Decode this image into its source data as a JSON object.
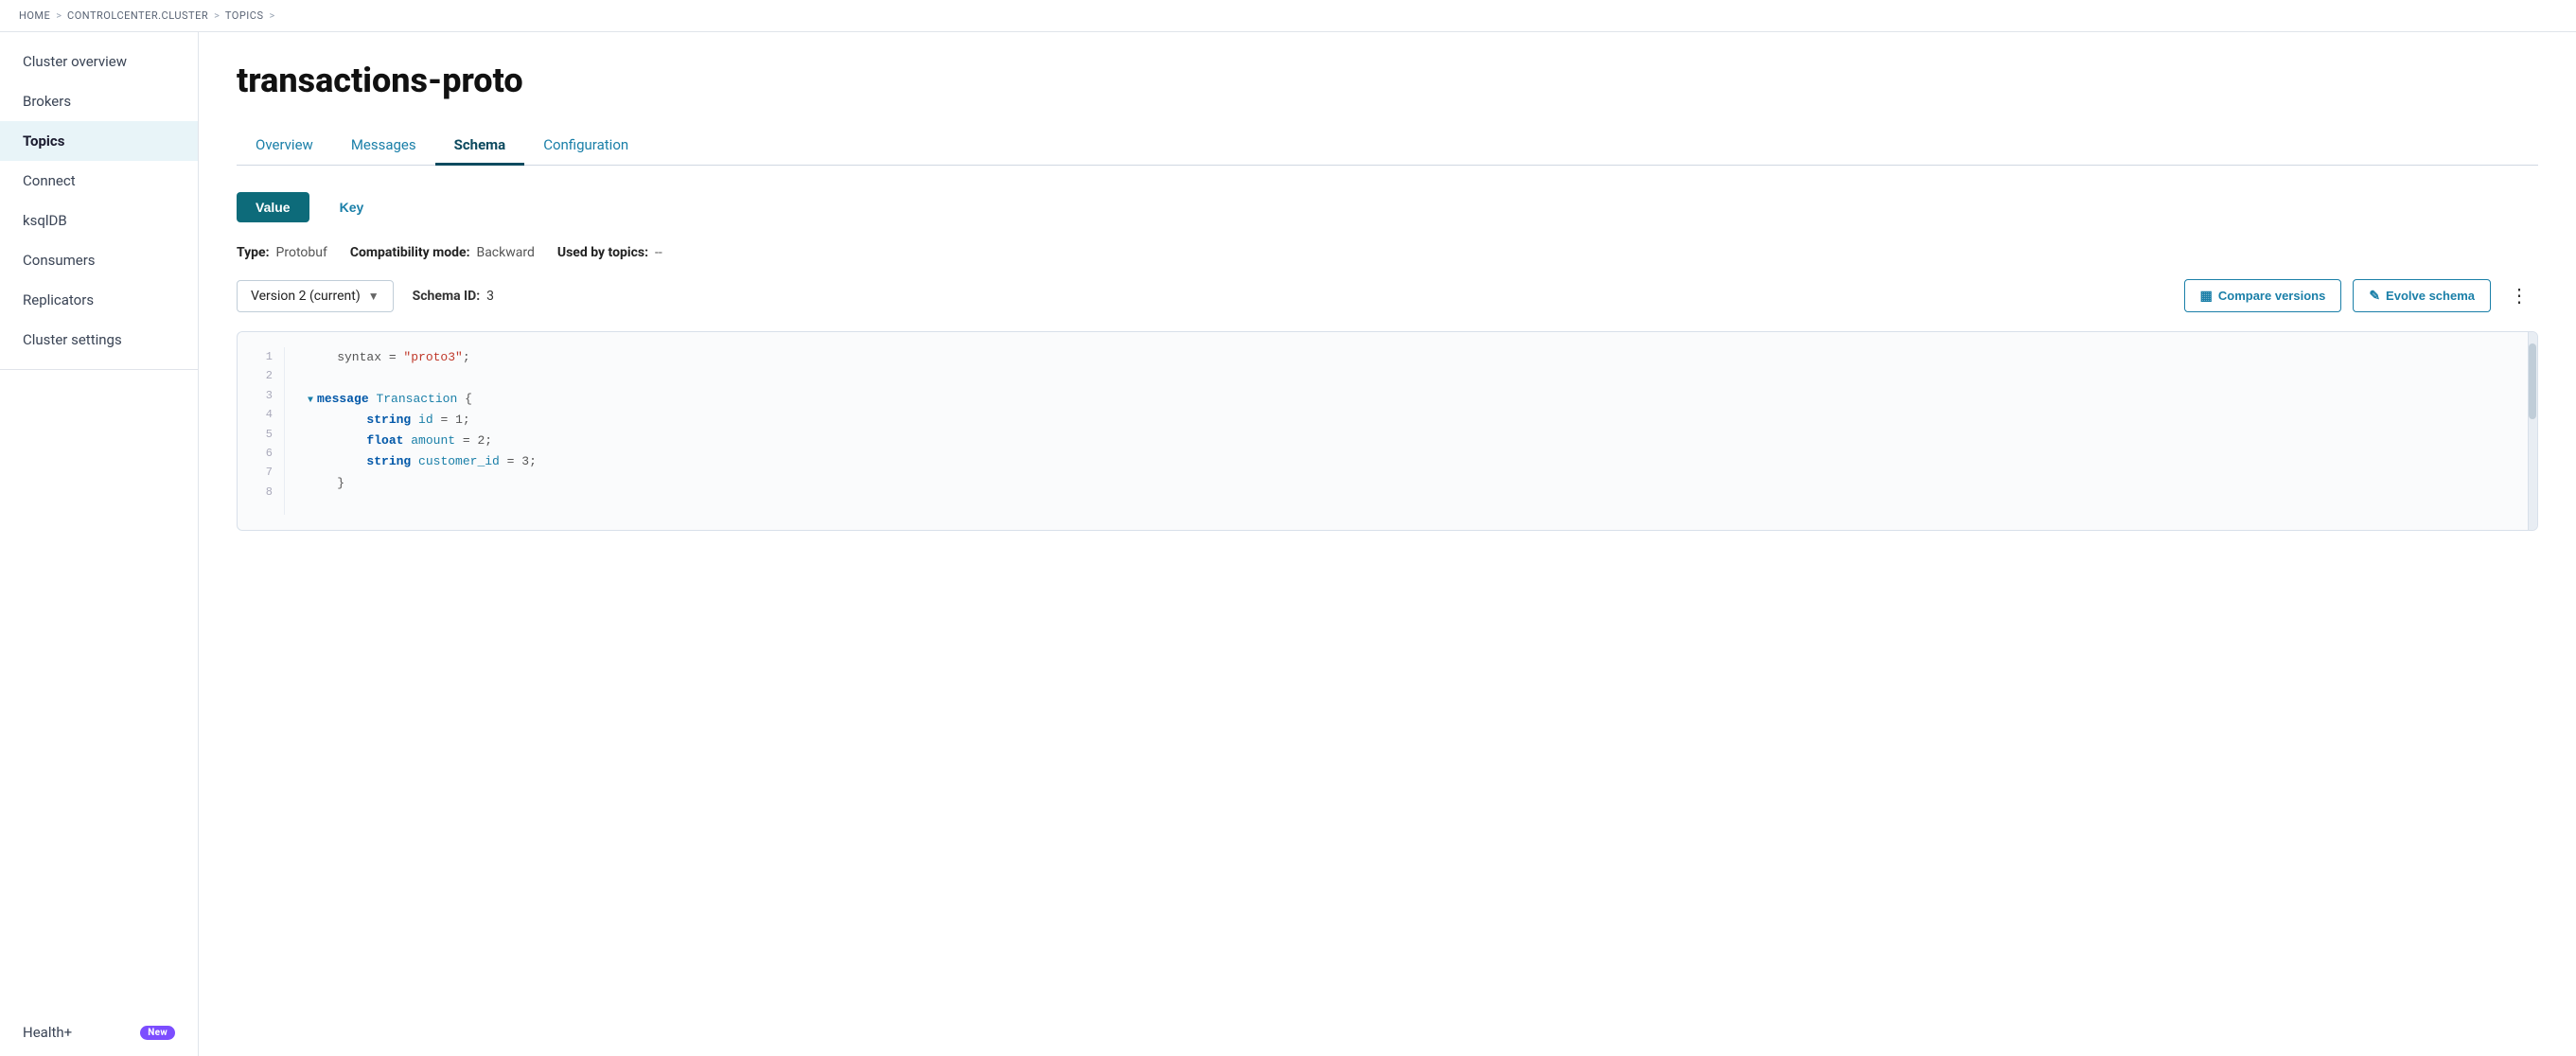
{
  "breadcrumb": {
    "items": [
      "HOME",
      "CONTROLCENTER.CLUSTER",
      "TOPICS"
    ],
    "separators": [
      ">",
      ">",
      ">"
    ]
  },
  "sidebar": {
    "items": [
      {
        "id": "cluster-overview",
        "label": "Cluster overview",
        "active": false
      },
      {
        "id": "brokers",
        "label": "Brokers",
        "active": false
      },
      {
        "id": "topics",
        "label": "Topics",
        "active": true
      },
      {
        "id": "connect",
        "label": "Connect",
        "active": false
      },
      {
        "id": "ksqldb",
        "label": "ksqlDB",
        "active": false
      },
      {
        "id": "consumers",
        "label": "Consumers",
        "active": false
      },
      {
        "id": "replicators",
        "label": "Replicators",
        "active": false
      },
      {
        "id": "cluster-settings",
        "label": "Cluster settings",
        "active": false
      }
    ],
    "bottom": {
      "label": "Health+",
      "badge": "New"
    }
  },
  "page": {
    "title": "transactions-proto",
    "tabs": [
      {
        "id": "overview",
        "label": "Overview",
        "active": false
      },
      {
        "id": "messages",
        "label": "Messages",
        "active": false
      },
      {
        "id": "schema",
        "label": "Schema",
        "active": true
      },
      {
        "id": "configuration",
        "label": "Configuration",
        "active": false
      }
    ],
    "toggle": {
      "value_label": "Value",
      "key_label": "Key",
      "active": "value"
    },
    "schema_meta": {
      "type_label": "Type:",
      "type_value": "Protobuf",
      "compat_label": "Compatibility mode:",
      "compat_value": "Backward",
      "used_label": "Used by topics:",
      "used_value": "--"
    },
    "version": {
      "select_label": "Version 2 (current)",
      "schema_id_label": "Schema ID:",
      "schema_id_value": "3"
    },
    "actions": {
      "compare_label": "Compare versions",
      "evolve_label": "Evolve schema",
      "more": "..."
    },
    "code": {
      "lines": [
        {
          "num": "1",
          "content": "    syntax = \"proto3\";",
          "parts": [
            {
              "text": "    syntax",
              "class": "field-name"
            },
            {
              "text": " = ",
              "class": "punct"
            },
            {
              "text": "\"proto3\"",
              "class": "str"
            },
            {
              "text": ";",
              "class": "punct"
            }
          ]
        },
        {
          "num": "2",
          "content": "",
          "parts": []
        },
        {
          "num": "3",
          "content": "    message Transaction {",
          "parts": [
            {
              "text": "    ",
              "class": ""
            },
            {
              "text": "message",
              "class": "kw"
            },
            {
              "text": " ",
              "class": ""
            },
            {
              "text": "Transaction",
              "class": "type-name"
            },
            {
              "text": " {",
              "class": "punct"
            }
          ],
          "collapsible": true
        },
        {
          "num": "4",
          "content": "        string id = 1;",
          "parts": [
            {
              "text": "        ",
              "class": ""
            },
            {
              "text": "string",
              "class": "kw"
            },
            {
              "text": " ",
              "class": ""
            },
            {
              "text": "id",
              "class": "type-name"
            },
            {
              "text": " = ",
              "class": "punct"
            },
            {
              "text": "1",
              "class": "num"
            },
            {
              "text": ";",
              "class": "punct"
            }
          ]
        },
        {
          "num": "5",
          "content": "        float amount = 2;",
          "parts": [
            {
              "text": "        ",
              "class": ""
            },
            {
              "text": "float",
              "class": "kw"
            },
            {
              "text": " ",
              "class": ""
            },
            {
              "text": "amount",
              "class": "type-name"
            },
            {
              "text": " = ",
              "class": "punct"
            },
            {
              "text": "2",
              "class": "num"
            },
            {
              "text": ";",
              "class": "punct"
            }
          ]
        },
        {
          "num": "6",
          "content": "        string customer_id = 3;",
          "parts": [
            {
              "text": "        ",
              "class": ""
            },
            {
              "text": "string",
              "class": "kw"
            },
            {
              "text": " ",
              "class": ""
            },
            {
              "text": "customer_id",
              "class": "type-name"
            },
            {
              "text": " = ",
              "class": "punct"
            },
            {
              "text": "3",
              "class": "num"
            },
            {
              "text": ";",
              "class": "punct"
            }
          ]
        },
        {
          "num": "7",
          "content": "    }",
          "parts": [
            {
              "text": "    }",
              "class": "punct"
            }
          ]
        },
        {
          "num": "8",
          "content": "",
          "parts": []
        }
      ]
    }
  }
}
